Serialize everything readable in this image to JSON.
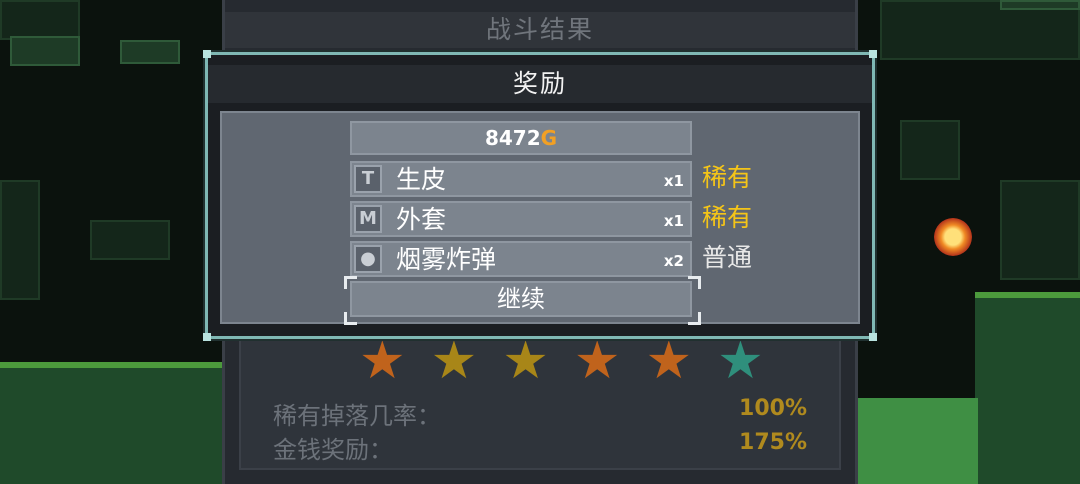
{
  "battle_result": {
    "title": "战斗结果",
    "stars": [
      {
        "color": "#c0631c"
      },
      {
        "color": "#a88618"
      },
      {
        "color": "#a88618"
      },
      {
        "color": "#c0631c"
      },
      {
        "color": "#c0631c"
      },
      {
        "color": "#2f8f7c"
      }
    ],
    "stats": [
      {
        "label": "稀有掉落几率：",
        "value": "100%"
      },
      {
        "label": "金钱奖励：",
        "value": "175%"
      }
    ]
  },
  "reward": {
    "title": "奖励",
    "gold_amount": "8472",
    "gold_unit": "G",
    "items": [
      {
        "icon": "hammer-icon",
        "glyph": "T",
        "name": "生皮",
        "qty": "x1",
        "rarity": "稀有",
        "rarity_color": "#f5c518"
      },
      {
        "icon": "coat-icon",
        "glyph": "M",
        "name": "外套",
        "qty": "x1",
        "rarity": "稀有",
        "rarity_color": "#f5c518"
      },
      {
        "icon": "smoke-bomb-icon",
        "glyph": "●",
        "name": "烟雾炸弹",
        "qty": "x2",
        "rarity": "普通",
        "rarity_color": "#e8e8e8"
      }
    ],
    "continue_label": "继续"
  }
}
